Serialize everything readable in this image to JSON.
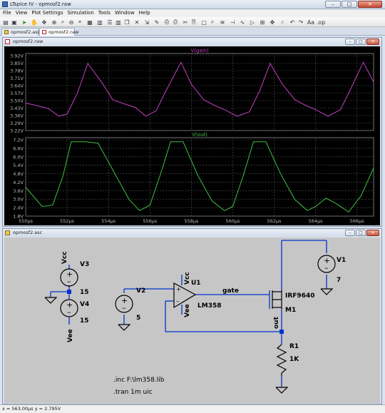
{
  "window": {
    "title": "LTspice IV - opmosf2.raw"
  },
  "menu": [
    "File",
    "View",
    "Plot Settings",
    "Simulation",
    "Tools",
    "Window",
    "Help"
  ],
  "tabs": [
    {
      "label": "opmosf2.asc"
    },
    {
      "label": "opmosf2.raw"
    }
  ],
  "waveform_window": {
    "title": "opmosf2.raw"
  },
  "schematic_window": {
    "title": "opmosf2.asc"
  },
  "chart_data": [
    {
      "type": "line",
      "title": "V(gain)",
      "series_color": "#c040c0",
      "x_ticks": [
        "550µs",
        "552µs",
        "554µs",
        "556µs",
        "558µs",
        "560µs",
        "562µs",
        "564µs",
        "566µs"
      ],
      "y_ticks": [
        "3.92V",
        "3.85V",
        "3.78V",
        "3.71V",
        "3.64V",
        "3.57V",
        "3.50V",
        "3.43V",
        "3.36V",
        "3.29V",
        "3.22V"
      ],
      "ylim": [
        3.22,
        3.92
      ],
      "xlim": [
        550,
        566.8
      ],
      "grid": true,
      "x": [
        550.0,
        551.1,
        551.6,
        552.0,
        552.5,
        553.0,
        553.7,
        554.2,
        554.8,
        555.3,
        555.8,
        556.3,
        556.8,
        557.5,
        558.0,
        558.6,
        559.1,
        559.6,
        560.2,
        560.8,
        561.3,
        561.8,
        562.4,
        563.0,
        563.5,
        564.0,
        564.6,
        565.2,
        565.7,
        566.3,
        566.8
      ],
      "values": [
        3.47,
        3.42,
        3.35,
        3.37,
        3.56,
        3.83,
        3.65,
        3.5,
        3.46,
        3.43,
        3.35,
        3.4,
        3.59,
        3.84,
        3.64,
        3.5,
        3.45,
        3.41,
        3.35,
        3.39,
        3.58,
        3.83,
        3.64,
        3.5,
        3.45,
        3.41,
        3.35,
        3.41,
        3.6,
        3.84,
        3.66
      ]
    },
    {
      "type": "line",
      "title": "V(out)",
      "series_color": "#40c040",
      "x_ticks": [
        "550µs",
        "552µs",
        "554µs",
        "556µs",
        "558µs",
        "560µs",
        "562µs",
        "564µs",
        "566µs"
      ],
      "y_ticks": [
        "7.2V",
        "6.6V",
        "6.0V",
        "5.4V",
        "4.8V",
        "4.2V",
        "3.6V",
        "3.0V",
        "2.4V",
        "1.8V"
      ],
      "ylim": [
        1.5,
        7.2
      ],
      "xlim": [
        550,
        566.8
      ],
      "grid": true,
      "x": [
        550.0,
        550.8,
        551.3,
        551.8,
        552.2,
        552.9,
        553.5,
        554.3,
        555.0,
        555.5,
        556.0,
        556.5,
        557.0,
        557.6,
        558.3,
        559.0,
        559.6,
        560.0,
        560.5,
        561.0,
        561.6,
        562.3,
        563.0,
        563.6,
        564.0,
        564.5,
        565.0,
        565.6,
        566.2,
        566.8
      ],
      "values": [
        3.6,
        2.2,
        2.3,
        4.4,
        6.9,
        6.9,
        6.8,
        4.6,
        2.7,
        1.9,
        2.3,
        4.5,
        6.9,
        6.9,
        4.5,
        2.6,
        1.9,
        2.2,
        4.4,
        6.9,
        6.9,
        4.6,
        2.7,
        1.9,
        2.2,
        2.8,
        2.4,
        1.8,
        3.0,
        5.0
      ]
    }
  ],
  "schematic": {
    "labels": {
      "vcc_top": "Vcc",
      "v3": "V3",
      "v3_val": "15",
      "v4": "V4",
      "v4_val": "15",
      "vee_left": "Vee",
      "v2": "V2",
      "v2_val": "5",
      "vcc_amp": "Vcc",
      "u1": "U1",
      "vee_amp": "Vee",
      "lm358": "LM358",
      "gate": "gate",
      "irf": "IRF9640",
      "m1": "M1",
      "out": "out",
      "v1": "V1",
      "v1_val": "7",
      "r1": "R1",
      "r1_val": "1K",
      "inc": ".inc F:\\lm358.lib",
      "tran": ".tran 1m uic"
    }
  },
  "status": {
    "text": "x = 563.00µs  y = 2.795V"
  },
  "colors": {
    "plot_bg": "#000000",
    "grid": "#555555",
    "schematic_bg": "#c6c6c6",
    "wire": "#0033cc",
    "component": "#000000"
  }
}
